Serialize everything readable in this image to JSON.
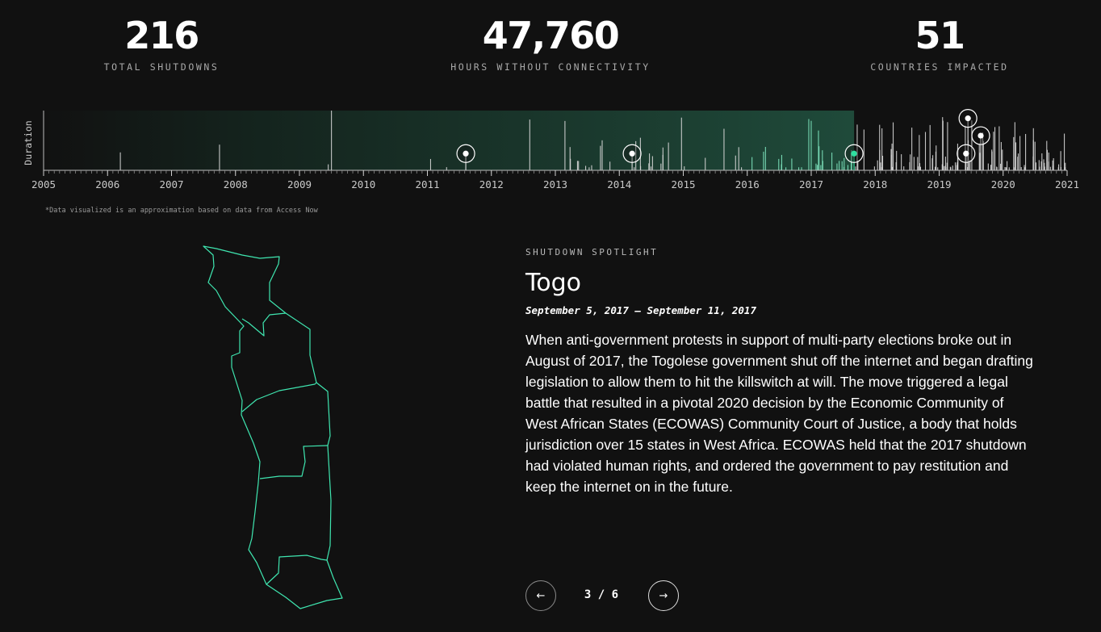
{
  "stats": [
    {
      "value": "216",
      "label": "TOTAL SHUTDOWNS"
    },
    {
      "value": "47,760",
      "label": "HOURS WITHOUT CONNECTIVITY"
    },
    {
      "value": "51",
      "label": "COUNTRIES IMPACTED"
    }
  ],
  "timeline": {
    "ylabel": "Duration",
    "years": [
      "2005",
      "2006",
      "2007",
      "2008",
      "2009",
      "2010",
      "2011",
      "2012",
      "2013",
      "2014",
      "2015",
      "2016",
      "2017",
      "2018",
      "2019",
      "2020",
      "2021"
    ],
    "highlight_end": 2017.67,
    "highlight_color": "#1f4a3a",
    "accent_color": "#2fe0a0",
    "footnote": "*Data visualized is an approximation based on data from Access Now",
    "markers": [
      {
        "year": 2011.6,
        "duration": 0.28,
        "active": false
      },
      {
        "year": 2014.2,
        "duration": 0.28,
        "active": false
      },
      {
        "year": 2017.67,
        "duration": 0.28,
        "active": true
      },
      {
        "year": 2019.45,
        "duration": 0.87,
        "active": false
      },
      {
        "year": 2019.65,
        "duration": 0.58,
        "active": false
      },
      {
        "year": 2019.42,
        "duration": 0.28,
        "active": false
      }
    ]
  },
  "spotlight": {
    "kicker": "SHUTDOWN SPOTLIGHT",
    "country": "Togo",
    "dates": "September 5, 2017 – September 11, 2017",
    "body": "When anti-government protests in support of multi-party elections broke out in August of 2017, the Togolese government shut off the internet and began drafting legislation to allow them to hit the killswitch at will. The move triggered a legal battle that resulted in a pivotal 2020 decision by the Economic Community of West African States (ECOWAS) Community Court of Justice, a body that holds jurisdiction over 15 states in West Africa. ECOWAS held that the 2017 shutdown had violated human rights, and ordered the government to pay restitution and keep the internet on in the future.",
    "map_color": "#3fe6b0"
  },
  "pager": {
    "current": "3 / 6",
    "prev_icon": "arrow-left-icon",
    "next_icon": "arrow-right-icon"
  }
}
